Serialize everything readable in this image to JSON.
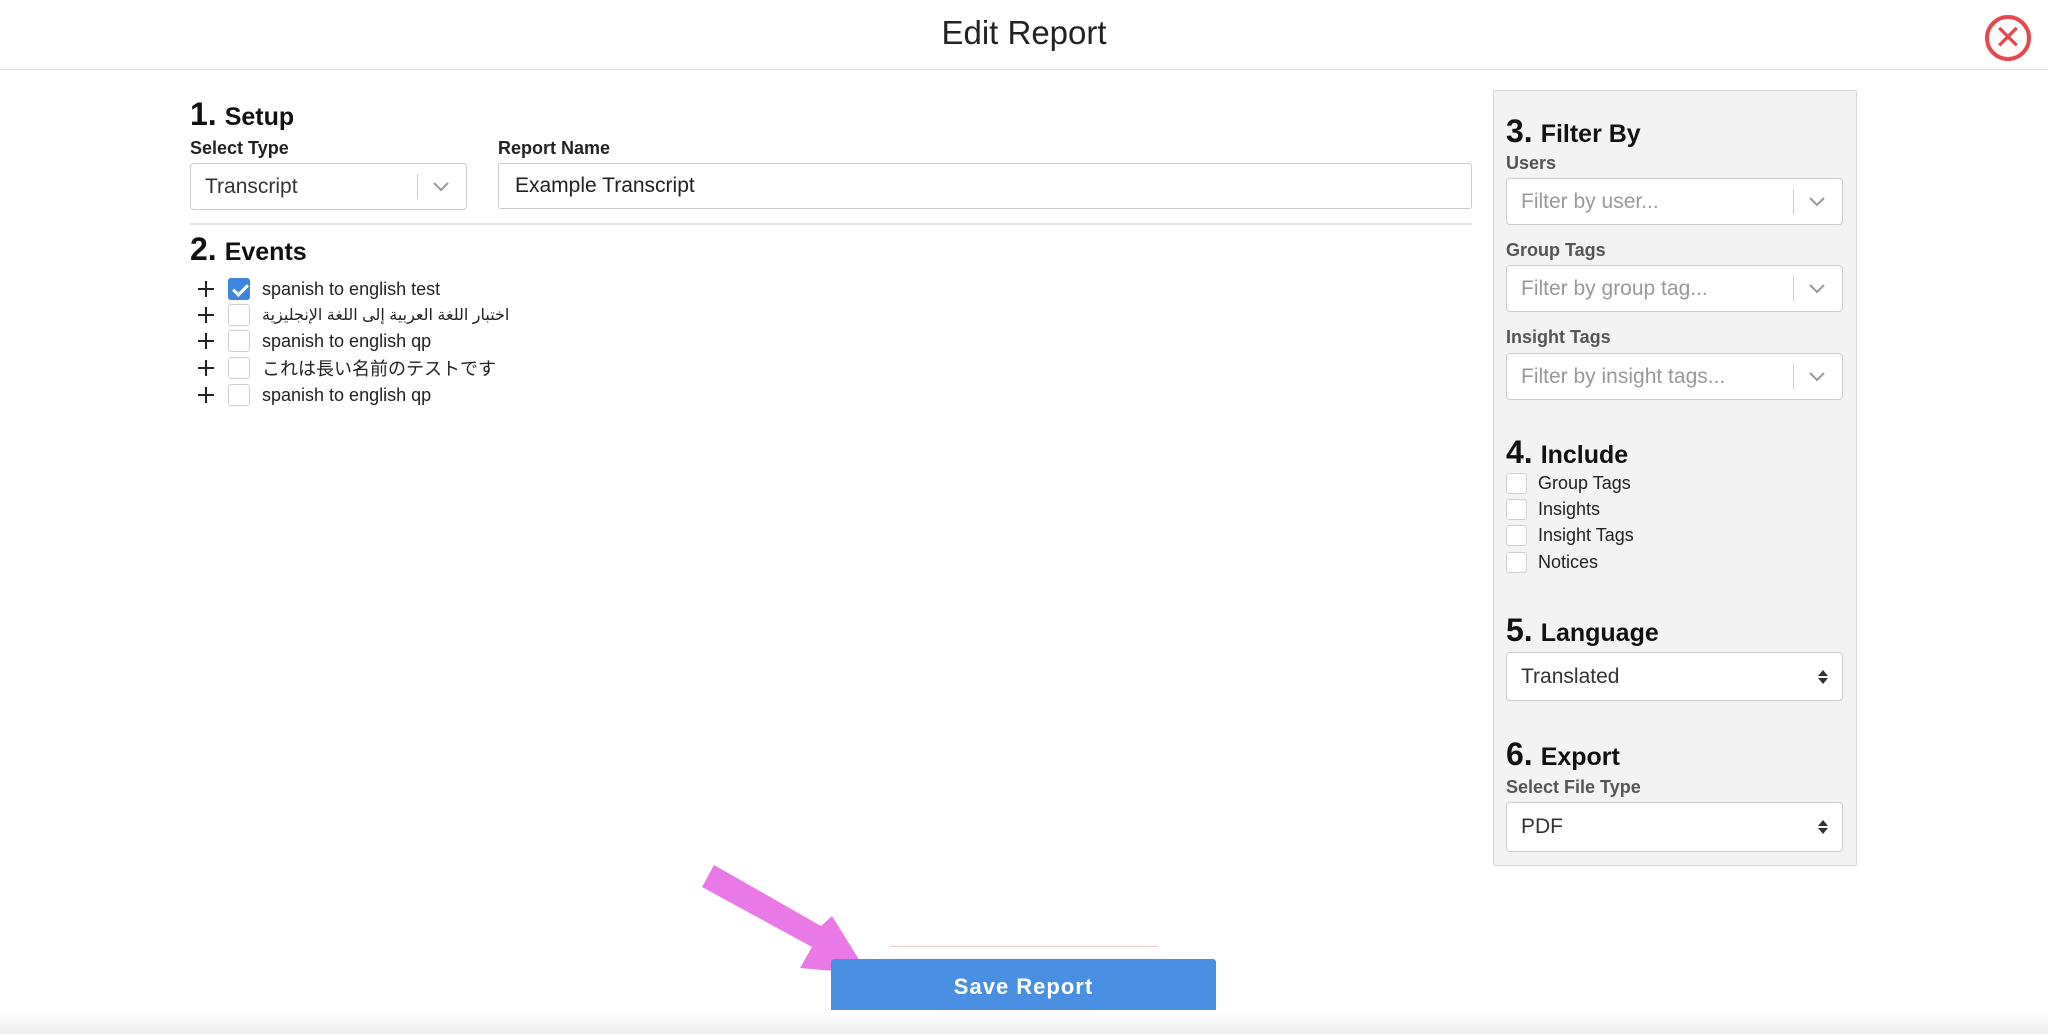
{
  "header": {
    "title": "Edit Report"
  },
  "setup": {
    "number": "1.",
    "title": "Setup",
    "type_label": "Select Type",
    "type_value": "Transcript",
    "name_label": "Report Name",
    "name_value": "Example Transcript"
  },
  "events": {
    "number": "2.",
    "title": "Events",
    "items": [
      {
        "label": "spanish to english test",
        "checked": true
      },
      {
        "label": "اختبار اللغة العربية إلى اللغة الإنجليزية",
        "checked": false
      },
      {
        "label": "spanish to english qp",
        "checked": false
      },
      {
        "label": "これは長い名前のテストです",
        "checked": false
      },
      {
        "label": "spanish to english qp",
        "checked": false
      }
    ]
  },
  "filter": {
    "number": "3.",
    "title": "Filter By",
    "users_label": "Users",
    "users_placeholder": "Filter by user...",
    "group_tags_label": "Group Tags",
    "group_tags_placeholder": "Filter by group tag...",
    "insight_tags_label": "Insight Tags",
    "insight_tags_placeholder": "Filter by insight tags..."
  },
  "include": {
    "number": "4.",
    "title": "Include",
    "items": [
      {
        "label": "Group Tags",
        "checked": false
      },
      {
        "label": "Insights",
        "checked": false
      },
      {
        "label": "Insight Tags",
        "checked": false
      },
      {
        "label": "Notices",
        "checked": false
      }
    ]
  },
  "language": {
    "number": "5.",
    "title": "Language",
    "value": "Translated"
  },
  "export": {
    "number": "6.",
    "title": "Export",
    "file_type_label": "Select File Type",
    "file_type_value": "PDF"
  },
  "actions": {
    "save_label": "Save Report"
  },
  "colors": {
    "accent": "#4a90e2",
    "close": "#e5484d",
    "arrow": "#e879e6",
    "checkbox_checked": "#3d86e0"
  }
}
